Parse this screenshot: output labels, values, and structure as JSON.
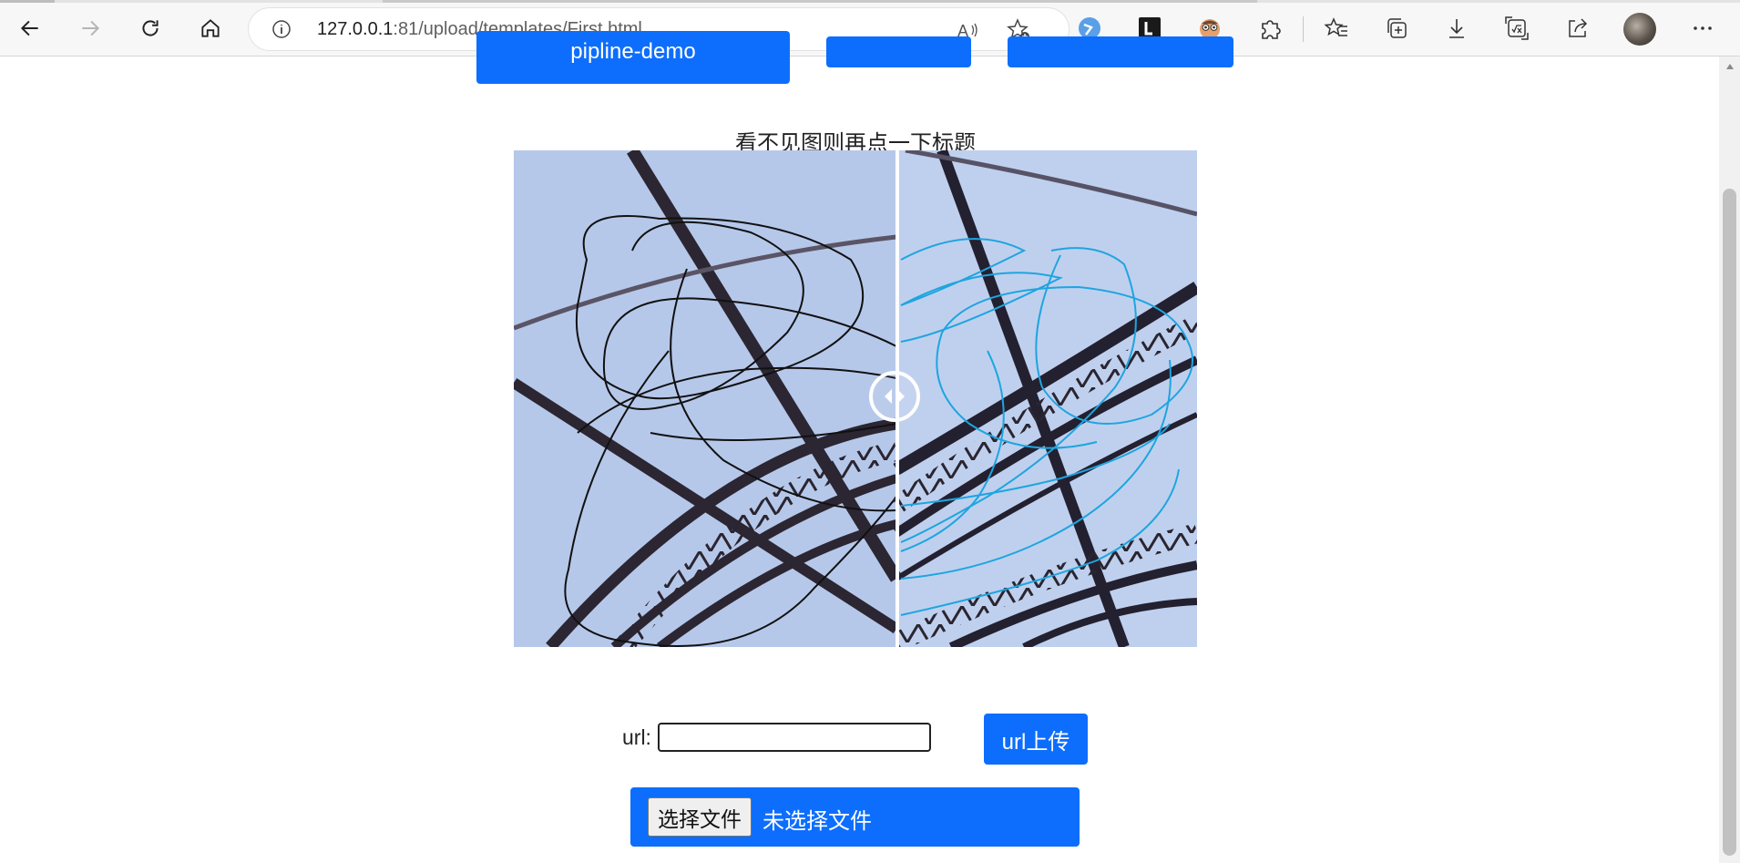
{
  "browser": {
    "url_host": "127.0.0.1",
    "url_rest": ":81/upload/templates/First.html",
    "icons": [
      "back-icon",
      "forward-icon",
      "refresh-icon",
      "home-icon",
      "info-icon",
      "read-aloud-icon",
      "add-favorite-icon",
      "extension-edge-icon",
      "extension-l-icon",
      "extension-face-icon",
      "extensions-puzzle-icon",
      "favorites-icon",
      "collections-icon",
      "downloads-icon",
      "math-solver-icon",
      "share-icon",
      "profile-avatar",
      "more-icon"
    ]
  },
  "page": {
    "top_buttons": [
      "pipline-demo",
      "",
      ""
    ],
    "hint_title": "看不见图则再点一下标题",
    "url_label": "url:",
    "url_input_value": "",
    "url_upload_button": "url上传",
    "file_choose_button": "选择文件",
    "file_none_text": "未选择文件"
  },
  "colors": {
    "primary_blue": "#0d6efd",
    "left_scribble": "#111111",
    "right_scribble": "#1ea5e0"
  }
}
